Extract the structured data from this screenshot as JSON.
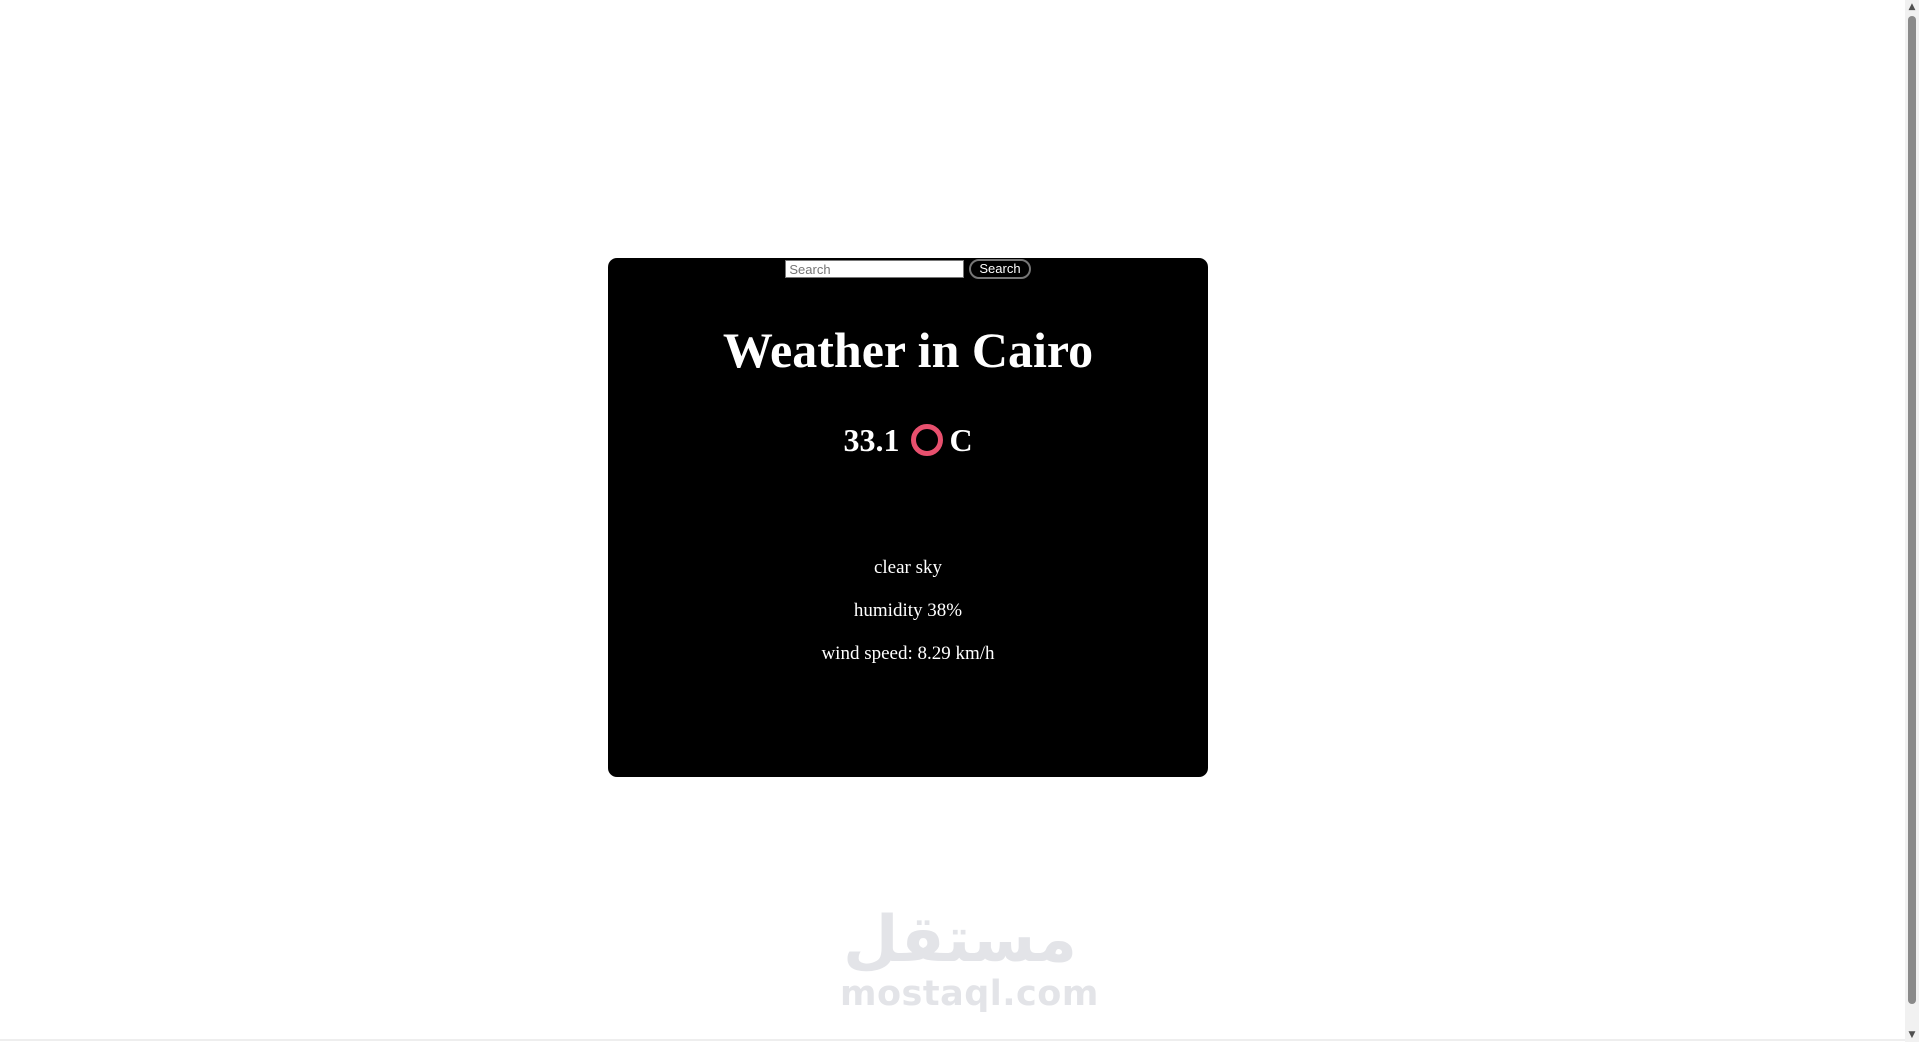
{
  "search": {
    "placeholder": "Search",
    "value": "",
    "button_label": "Search"
  },
  "weather": {
    "title": "Weather in Cairo",
    "temperature": "33.1",
    "unit": "C",
    "description": "clear sky",
    "humidity": "humidity 38%",
    "wind": "wind speed: 8.29 km/h"
  },
  "watermark": {
    "arabic": "مستقل",
    "latin": "mostaql.com"
  },
  "colors": {
    "card_background": "#000000",
    "degree_ring": "#e8506e",
    "watermark": "#e3e4e8"
  },
  "icons": {
    "degree": "degree-ring-icon",
    "scroll_up": "chevron-up-icon",
    "scroll_down": "chevron-down-icon"
  }
}
